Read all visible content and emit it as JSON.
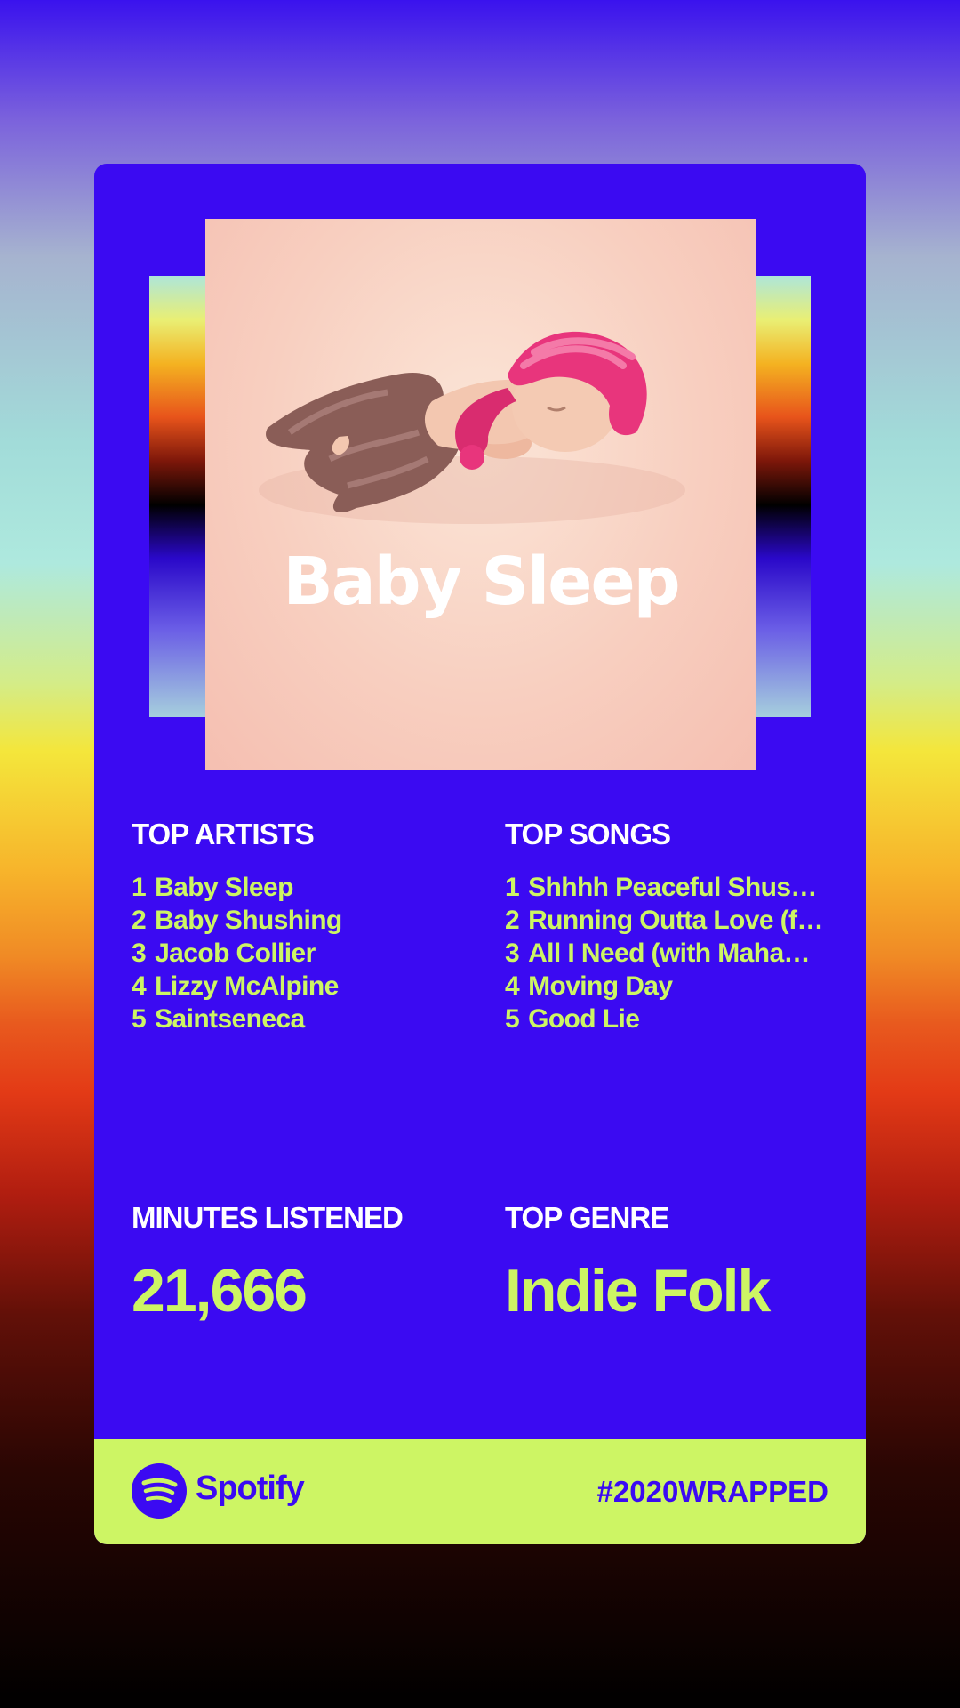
{
  "cover": {
    "title": "Baby Sleep",
    "image": "sleeping-baby-with-pink-knit-hat"
  },
  "top_artists": {
    "label": "TOP ARTISTS",
    "items": [
      {
        "rank": "1",
        "name": "Baby Sleep"
      },
      {
        "rank": "2",
        "name": "Baby Shushing"
      },
      {
        "rank": "3",
        "name": "Jacob Collier"
      },
      {
        "rank": "4",
        "name": "Lizzy McAlpine"
      },
      {
        "rank": "5",
        "name": "Saintseneca"
      }
    ]
  },
  "top_songs": {
    "label": "TOP SONGS",
    "items": [
      {
        "rank": "1",
        "name": "Shhhh Peaceful Shus…"
      },
      {
        "rank": "2",
        "name": "Running Outta Love (f…"
      },
      {
        "rank": "3",
        "name": "All I Need (with Maha…"
      },
      {
        "rank": "4",
        "name": "Moving Day"
      },
      {
        "rank": "5",
        "name": "Good Lie"
      }
    ]
  },
  "minutes": {
    "label": "MINUTES LISTENED",
    "value": "21,666"
  },
  "genre": {
    "label": "TOP GENRE",
    "value": "Indie Folk"
  },
  "footer": {
    "brand": "Spotify",
    "brand_icon": "spotify-logo-icon",
    "hashtag": "#2020WRAPPED"
  },
  "colors": {
    "card": "#3b0af2",
    "accent": "#cdf564",
    "text": "#ffffff"
  }
}
